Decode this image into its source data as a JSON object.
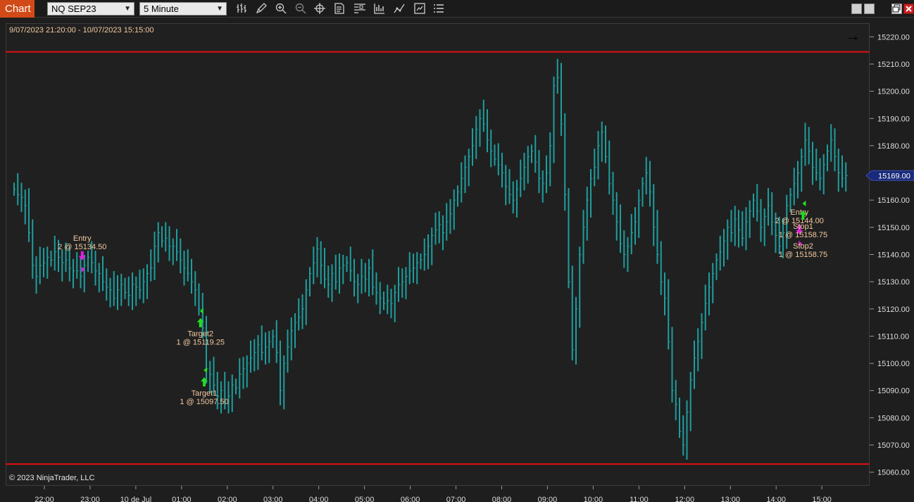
{
  "toolbar": {
    "tab_label": "Chart",
    "instrument": "NQ SEP23",
    "interval": "5 Minute",
    "tools": [
      "bar-type-icon",
      "draw-pencil-icon",
      "zoom-in-icon",
      "zoom-out-icon",
      "crosshair-icon",
      "data-box-icon",
      "properties-icon",
      "indicators-icon",
      "strategies-icon",
      "chart-trader-icon",
      "menu-icon"
    ]
  },
  "chart": {
    "range_label": "9/07/2023 21:20:00 - 10/07/2023 15:15:00",
    "copyright": "© 2023 NinjaTrader, LLC",
    "last_price_label": "15169.00",
    "colors": {
      "bars": "#1f9d9d",
      "lines": "#e01010",
      "text": "#f2c9a0",
      "buy": "#22dd22",
      "sell": "#e020e0",
      "price_tag": "#1a2a7a"
    }
  },
  "chart_data": {
    "type": "bar",
    "ylim": [
      15055,
      15225
    ],
    "price_ticks": [
      "15220.00",
      "15210.00",
      "15200.00",
      "15190.00",
      "15180.00",
      "15170.00",
      "15160.00",
      "15150.00",
      "15140.00",
      "15130.00",
      "15120.00",
      "15110.00",
      "15100.00",
      "15090.00",
      "15080.00",
      "15070.00",
      "15060.00"
    ],
    "time_ticks": [
      "22:00",
      "23:00",
      "10 de Jul",
      "01:00",
      "02:00",
      "03:00",
      "04:00",
      "05:00",
      "06:00",
      "07:00",
      "08:00",
      "09:00",
      "10:00",
      "11:00",
      "12:00",
      "13:00",
      "14:00",
      "15:00"
    ],
    "horizontal_lines": [
      15214.5,
      15063
    ],
    "closes": [
      15164,
      15162,
      15161,
      15158,
      15148,
      15136,
      15132,
      15136,
      15137,
      15139,
      15138,
      15141,
      15139,
      15137,
      15138,
      15135,
      15134,
      15134,
      15132,
      15136,
      15139,
      15137,
      15134,
      15133,
      15130,
      15128,
      15127,
      15124,
      15127,
      15129,
      15126,
      15125,
      15129,
      15128,
      15127,
      15130,
      15133,
      15135,
      15143,
      15148,
      15145,
      15146,
      15143,
      15143,
      15141,
      15138,
      15135,
      15133,
      15130,
      15127,
      15120,
      15113,
      15098,
      15096,
      15092,
      15088,
      15090,
      15086,
      15088,
      15092,
      15091,
      15096,
      15098,
      15100,
      15102,
      15104,
      15107,
      15104,
      15106,
      15108,
      15110,
      15104,
      15090,
      15100,
      15106,
      15112,
      15115,
      15117,
      15120,
      15127,
      15133,
      15137,
      15142,
      15136,
      15131,
      15129,
      15133,
      15130,
      15135,
      15136,
      15137,
      15134,
      15130,
      15129,
      15132,
      15131,
      15135,
      15128,
      15126,
      15124,
      15122,
      15123,
      15122,
      15126,
      15129,
      15130,
      15132,
      15134,
      15135,
      15137,
      15138,
      15140,
      15143,
      15147,
      15149,
      15151,
      15148,
      15152,
      15155,
      15160,
      15163,
      15168,
      15172,
      15176,
      15180,
      15186,
      15190,
      15188,
      15182,
      15178,
      15175,
      15173,
      15170,
      15165,
      15162,
      15160,
      15164,
      15168,
      15172,
      15176,
      15178,
      15174,
      15168,
      15166,
      15170,
      15180,
      15202,
      15205,
      15188,
      15162,
      15130,
      15105,
      15120,
      15140,
      15150,
      15160,
      15168,
      15172,
      15180,
      15185,
      15176,
      15166,
      15160,
      15152,
      15144,
      15140,
      15143,
      15148,
      15152,
      15160,
      15166,
      15170,
      15163,
      15150,
      15140,
      15130,
      15124,
      15108,
      15090,
      15085,
      15075,
      15070,
      15082,
      15094,
      15102,
      15108,
      15115,
      15122,
      15128,
      15133,
      15138,
      15141,
      15145,
      15150,
      15148,
      15153,
      15149,
      15146,
      15152,
      15156,
      15160,
      15156,
      15150,
      15154,
      15158,
      15152,
      15147,
      15143,
      15148,
      15158,
      15162,
      15166,
      15170,
      15176,
      15182,
      15178,
      15172,
      15170,
      15168,
      15173,
      15178,
      15182,
      15176,
      15170,
      15168,
      15169
    ],
    "bar_spread": 6,
    "annotations": [
      {
        "label": "Entry",
        "detail": "2 @ 15134.50",
        "kind": "entry-sell",
        "bar": 19,
        "price": 15134.5
      },
      {
        "label": "Target2",
        "detail": "1 @ 15119.25",
        "kind": "exit-buy",
        "bar": 51,
        "price": 15119.25
      },
      {
        "label": "Target1",
        "detail": "1 @ 15097.50",
        "kind": "exit-buy",
        "bar": 52,
        "price": 15097.5
      },
      {
        "label": "Entry",
        "detail": "2 @ 15144.00",
        "kind": "entry-sell",
        "bar": 213,
        "price": 15144
      },
      {
        "label": "Stop1",
        "detail": "1 @ 15158.75",
        "kind": "exit-buy",
        "bar": 214,
        "price": 15158.75
      },
      {
        "label": "Stop2",
        "detail": "1 @ 15158.75",
        "kind": "exit-buy",
        "bar": 214,
        "price": 15158.75
      }
    ]
  }
}
